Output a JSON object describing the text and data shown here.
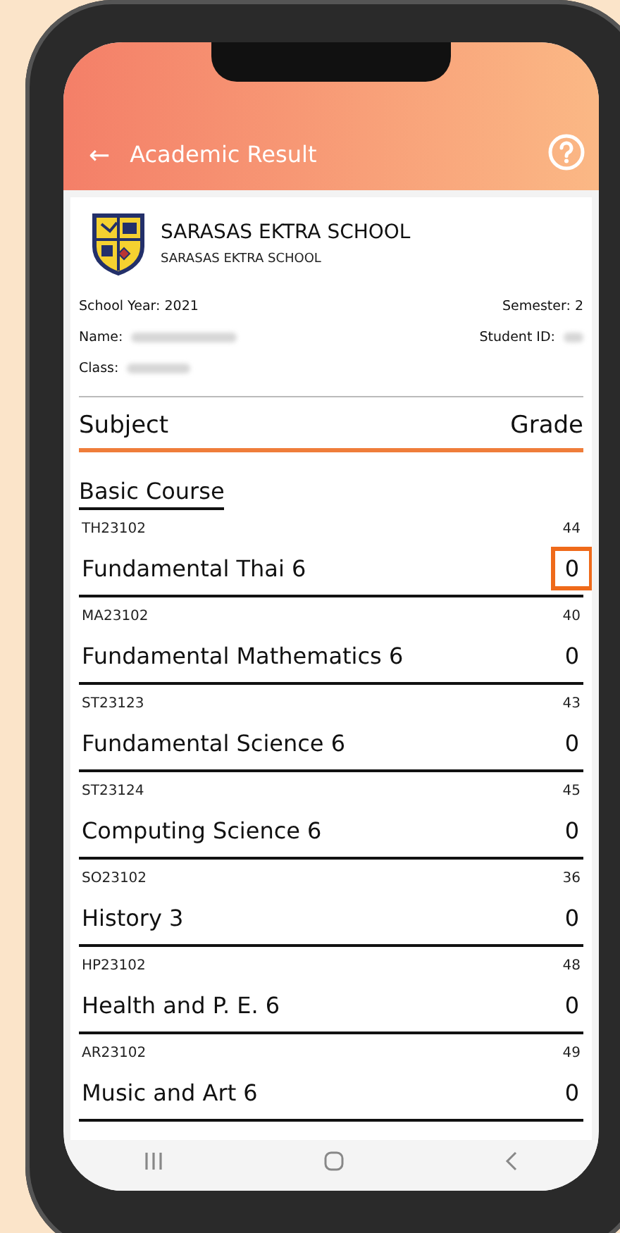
{
  "header": {
    "back": "←",
    "title": "Academic Result"
  },
  "school": {
    "name": "SARASAS EKTRA SCHOOL",
    "subname": "SARASAS EKTRA SCHOOL"
  },
  "info": {
    "school_year": "School Year: 2021",
    "semester": "Semester: 2",
    "name_label": "Name:",
    "student_id_label": "Student ID:",
    "class_label": "Class:"
  },
  "table": {
    "subject_heading": "Subject",
    "grade_heading": "Grade"
  },
  "section": "Basic Course",
  "subjects": [
    {
      "code": "TH23102",
      "score": "44",
      "name": "Fundamental Thai 6",
      "grade": "0",
      "highlighted": true
    },
    {
      "code": "MA23102",
      "score": "40",
      "name": "Fundamental Mathematics 6",
      "grade": "0",
      "highlighted": false
    },
    {
      "code": "ST23123",
      "score": "43",
      "name": "Fundamental Science 6",
      "grade": "0",
      "highlighted": false
    },
    {
      "code": "ST23124",
      "score": "45",
      "name": "Computing Science 6",
      "grade": "0",
      "highlighted": false
    },
    {
      "code": "SO23102",
      "score": "36",
      "name": "History 3",
      "grade": "0",
      "highlighted": false
    },
    {
      "code": "HP23102",
      "score": "48",
      "name": "Health and P. E. 6",
      "grade": "0",
      "highlighted": false
    },
    {
      "code": "AR23102",
      "score": "49",
      "name": "Music and Art 6",
      "grade": "0",
      "highlighted": false
    }
  ]
}
